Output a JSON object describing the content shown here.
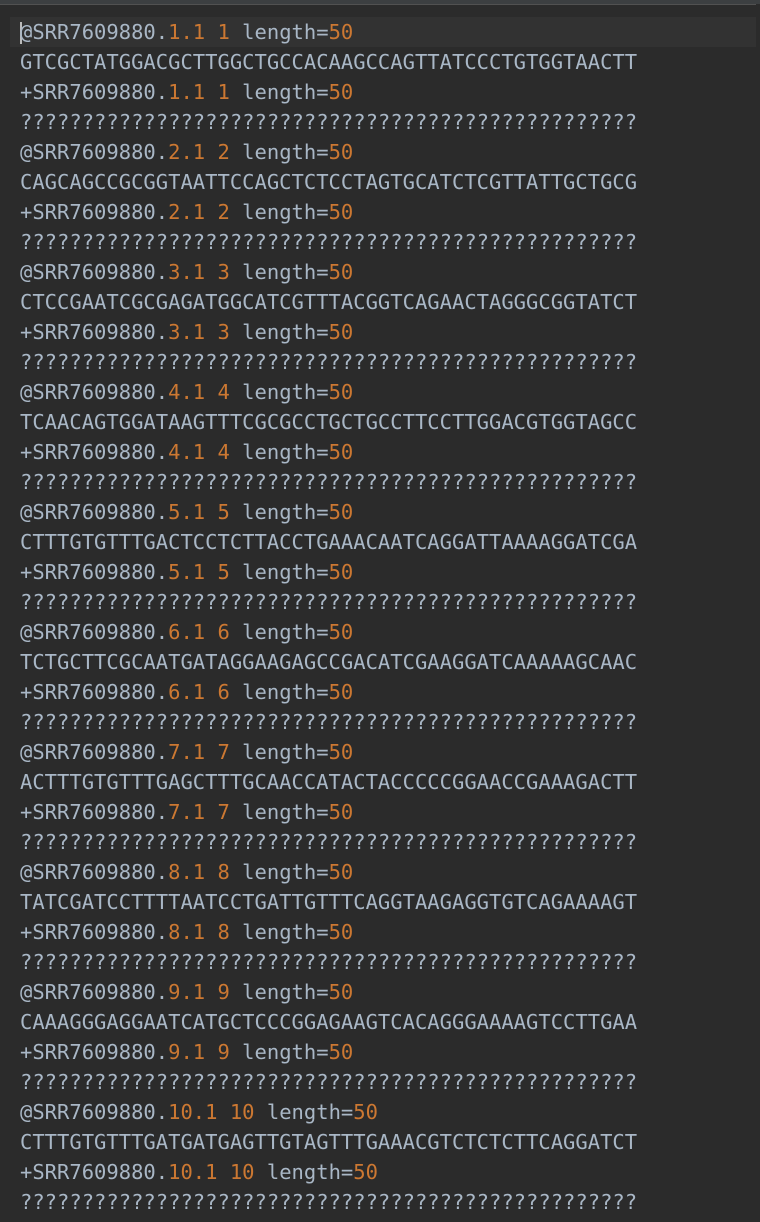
{
  "file": {
    "read_id_prefix": "SRR7609880",
    "length_key": "length=",
    "quality_line": "??????????????????????????????????????????????????",
    "records": [
      {
        "spot": "1",
        "read": "1",
        "count": "1",
        "length": "50",
        "sequence": "GTCGCTATGGACGCTTGGCTGCCACAAGCCAGTTATCCCTGTGGTAACTT"
      },
      {
        "spot": "2",
        "read": "1",
        "count": "2",
        "length": "50",
        "sequence": "CAGCAGCCGCGGTAATTCCAGCTCTCCTAGTGCATCTCGTTATTGCTGCG"
      },
      {
        "spot": "3",
        "read": "1",
        "count": "3",
        "length": "50",
        "sequence": "CTCCGAATCGCGAGATGGCATCGTTTACGGTCAGAACTAGGGCGGTATCT"
      },
      {
        "spot": "4",
        "read": "1",
        "count": "4",
        "length": "50",
        "sequence": "TCAACAGTGGATAAGTTTCGCGCCTGCTGCCTTCCTTGGACGTGGTAGCC"
      },
      {
        "spot": "5",
        "read": "1",
        "count": "5",
        "length": "50",
        "sequence": "CTTTGTGTTTGACTCCTCTTACCTGAAACAATCAGGATTAAAAGGATCGA"
      },
      {
        "spot": "6",
        "read": "1",
        "count": "6",
        "length": "50",
        "sequence": "TCTGCTTCGCAATGATAGGAAGAGCCGACATCGAAGGATCAAAAAGCAAC"
      },
      {
        "spot": "7",
        "read": "1",
        "count": "7",
        "length": "50",
        "sequence": "ACTTTGTGTTTGAGCTTTGCAACCATACTACCCCCGGAACCGAAAGACTT"
      },
      {
        "spot": "8",
        "read": "1",
        "count": "8",
        "length": "50",
        "sequence": "TATCGATCCTTTTAATCCTGATTGTTTCAGGTAAGAGGTGTCAGAAAAGT"
      },
      {
        "spot": "9",
        "read": "1",
        "count": "9",
        "length": "50",
        "sequence": "CAAAGGGAGGAATCATGCTCCCGGAGAAGTCACAGGGAAAAGTCCTTGAA"
      },
      {
        "spot": "10",
        "read": "1",
        "count": "10",
        "length": "50",
        "sequence": "CTTTGTGTTTGATGATGAGTTGTAGTTTGAAACGTCTCTCTTCAGGATCT"
      }
    ]
  },
  "colors": {
    "background": "#2b2b2b",
    "text": "#a9b7c6",
    "number": "#cc7832",
    "current_line": "#323232"
  }
}
